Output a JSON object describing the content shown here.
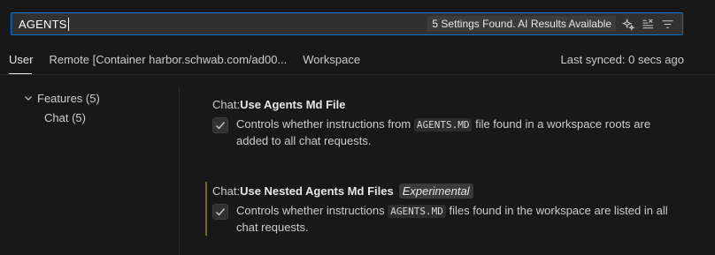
{
  "search": {
    "value": "AGENTS",
    "results_badge": "5 Settings Found. AI Results Available",
    "icons": [
      "ai-sparkle-icon",
      "clear-filter-icon",
      "filter-icon"
    ]
  },
  "tabs": [
    {
      "label": "User",
      "active": true
    },
    {
      "label": "Remote [Container harbor.schwab.com/ad00...",
      "active": false
    },
    {
      "label": "Workspace",
      "active": false
    }
  ],
  "last_synced": "Last synced: 0 secs ago",
  "toc": {
    "features_label": "Features (5)",
    "chat_label": "Chat (5)"
  },
  "settings": [
    {
      "category": "Chat: ",
      "name": "Use Agents Md File",
      "checked": true,
      "desc_pre": "Controls whether instructions from ",
      "desc_code": "AGENTS.MD",
      "desc_post": " file found in a workspace roots are added to all chat requests."
    },
    {
      "category": "Chat: ",
      "name": "Use Nested Agents Md Files",
      "tag": "Experimental",
      "checked": true,
      "desc_pre": "Controls whether instructions ",
      "desc_code": "AGENTS.MD",
      "desc_post": " files found in the workspace are listed in all chat requests."
    }
  ],
  "colors": {
    "accent": "#0078d4",
    "background": "#181818",
    "focus_indicator": "#7a6338"
  }
}
